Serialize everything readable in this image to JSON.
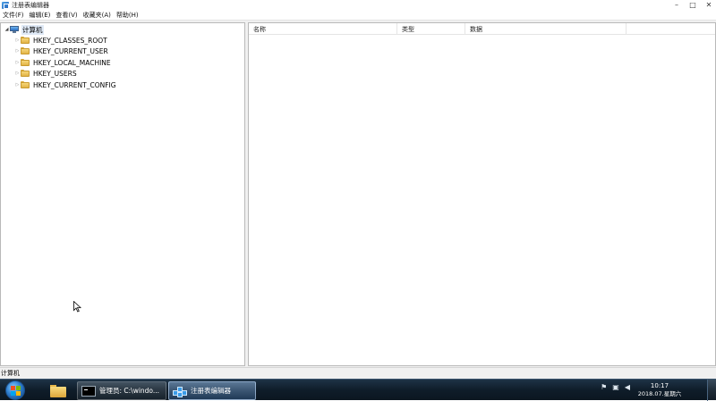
{
  "window": {
    "title": "注册表编辑器",
    "controls": {
      "minimize": "–",
      "maximize": "□",
      "close": "✕"
    }
  },
  "menu": {
    "items": [
      "文件(F)",
      "编辑(E)",
      "查看(V)",
      "收藏夹(A)",
      "帮助(H)"
    ]
  },
  "tree": {
    "root": {
      "label": "计算机",
      "expander": "◢"
    },
    "keys": [
      {
        "label": "HKEY_CLASSES_ROOT",
        "expander": "▷"
      },
      {
        "label": "HKEY_CURRENT_USER",
        "expander": "▷"
      },
      {
        "label": "HKEY_LOCAL_MACHINE",
        "expander": "▷"
      },
      {
        "label": "HKEY_USERS",
        "expander": "▷"
      },
      {
        "label": "HKEY_CURRENT_CONFIG",
        "expander": "▷"
      }
    ]
  },
  "list": {
    "columns": [
      "名称",
      "类型",
      "数据"
    ]
  },
  "statusbar": {
    "path": "计算机"
  },
  "taskbar": {
    "cmd_label": "管理员: C:\\windo...",
    "regedit_label": "注册表编辑器",
    "tray": {
      "flag": "⚑",
      "network": "▣",
      "volume": "◀"
    },
    "clock": {
      "time": "10:17",
      "date": "2018.07.星期六"
    }
  },
  "colors": {
    "selection": "#dfe9f6",
    "taskbar": "#0f1d2a",
    "folder": "#f6d77a"
  },
  "icons": {
    "app": "regedit-icon",
    "root": "computer-icon",
    "key": "folder-icon"
  }
}
